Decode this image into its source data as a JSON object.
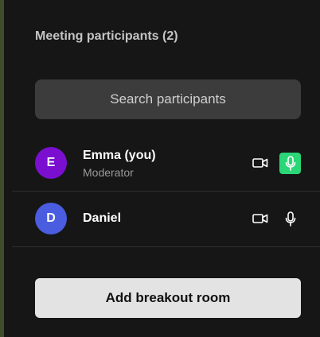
{
  "panel": {
    "title": "Meeting participants (2)"
  },
  "search": {
    "placeholder": "Search participants",
    "value": ""
  },
  "participants": [
    {
      "initial": "E",
      "name": "Emma (you)",
      "role": "Moderator",
      "avatar_color": "#7a0fd0",
      "camera_icon": "video-camera-icon",
      "mic_icon": "microphone-icon",
      "mic_active": true,
      "mic_active_color": "#2bd677"
    },
    {
      "initial": "D",
      "name": "Daniel",
      "role": "",
      "avatar_color": "#4a5de0",
      "camera_icon": "video-camera-icon",
      "mic_icon": "microphone-icon",
      "mic_active": false
    }
  ],
  "actions": {
    "add_breakout_label": "Add breakout room"
  }
}
